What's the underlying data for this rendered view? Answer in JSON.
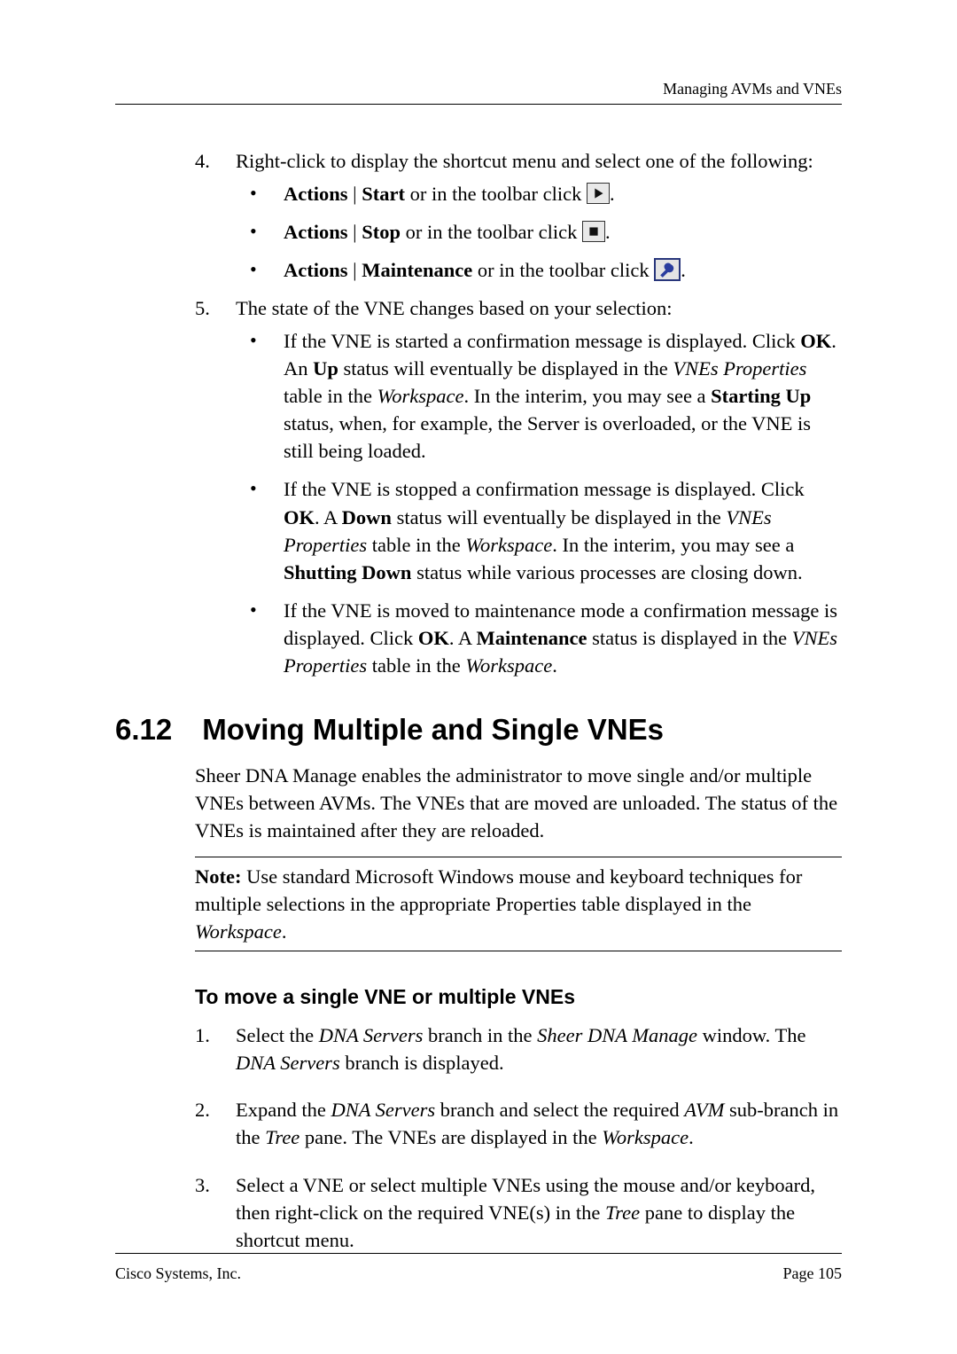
{
  "header": {
    "running": "Managing AVMs and VNEs"
  },
  "step4": {
    "num": "4.",
    "text_a": "Right-click to display the shortcut menu and select one of the following:",
    "b1_a": "Actions",
    "b1_pipe": " | ",
    "b1_b": "Start",
    "b1_c": " or in the toolbar click ",
    "b2_a": "Actions",
    "b2_pipe": " | ",
    "b2_b": "Stop",
    "b2_c": " or in the toolbar click ",
    "b3_a": "Actions",
    "b3_pipe": " | ",
    "b3_b": "Maintenance",
    "b3_c": " or in the toolbar click ",
    "period": "."
  },
  "step5": {
    "num": "5.",
    "text": "The state of the VNE changes based on your selection:",
    "b1_a": "If the VNE is started a confirmation message is displayed. Click ",
    "b1_ok": "OK",
    "b1_b": ". An ",
    "b1_up": "Up",
    "b1_c": " status will eventually be displayed in the ",
    "b1_vp": "VNEs Properties",
    "b1_d": " table in the ",
    "b1_ws": "Workspace",
    "b1_e": ". In the interim, you may see a ",
    "b1_su": "Starting Up",
    "b1_f": " status, when, for example, the Server is overloaded, or the VNE is still being loaded.",
    "b2_a": "If the VNE is stopped a confirmation message is displayed. Click ",
    "b2_ok": "OK",
    "b2_b": ". A ",
    "b2_down": "Down",
    "b2_c": " status will eventually be displayed in the ",
    "b2_vp": "VNEs Properties",
    "b2_d": " table in the ",
    "b2_ws": "Workspace",
    "b2_e": ". In the interim, you may see a ",
    "b2_sd": "Shutting Down",
    "b2_f": " status while various processes are closing down.",
    "b3_a": "If the VNE is moved to maintenance mode a confirmation message is displayed. Click ",
    "b3_ok": "OK",
    "b3_b": ". A ",
    "b3_m": "Maintenance",
    "b3_c": " status is displayed in the ",
    "b3_vp": "VNEs Properties",
    "b3_d": " table in the ",
    "b3_ws": "Workspace",
    "b3_e": "."
  },
  "section": {
    "num": "6.12",
    "title": "Moving Multiple and Single VNEs",
    "p1": "Sheer DNA Manage enables the administrator to move single and/or multiple VNEs between AVMs. The VNEs that are moved are unloaded. The status of the VNEs is maintained after they are reloaded.",
    "note_label": "Note:",
    "note_body_a": " Use standard Microsoft Windows mouse and keyboard techniques for multiple selections in the appropriate Properties table displayed in the ",
    "note_ws": "Workspace",
    "note_body_b": "."
  },
  "subhead": "To move a single VNE or multiple VNEs",
  "steps": {
    "s1_num": "1.",
    "s1_a": "Select the ",
    "s1_ds": "DNA Servers",
    "s1_b": " branch in the ",
    "s1_win": "Sheer DNA Manage",
    "s1_c": " window. The ",
    "s1_ds2": "DNA Servers",
    "s1_d": " branch is displayed.",
    "s2_num": "2.",
    "s2_a": "Expand the ",
    "s2_ds": "DNA Servers",
    "s2_b": " branch and select the required ",
    "s2_avm": "AVM",
    "s2_c": " sub-branch in the ",
    "s2_tree": "Tree",
    "s2_d": " pane. The VNEs are displayed in the ",
    "s2_ws": "Workspace",
    "s2_e": ".",
    "s3_num": "3.",
    "s3_a": "Select a VNE or select multiple VNEs using the mouse and/or keyboard, then right-click on the required VNE(s) in the ",
    "s3_tree": "Tree",
    "s3_b": " pane to display the shortcut menu."
  },
  "footer": {
    "left": "Cisco Systems, Inc.",
    "right": "Page 105"
  }
}
